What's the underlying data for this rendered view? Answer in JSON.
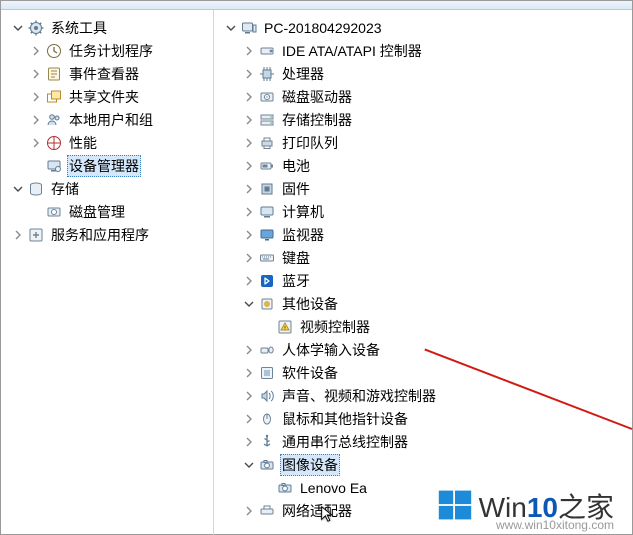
{
  "watermark": {
    "brand_a": "Win",
    "brand_b": "10",
    "brand_c": "之家",
    "url": "www.win10xitong.com"
  },
  "icons": {
    "gear": "<svg viewBox='0 0 16 16'><circle cx='8' cy='8' r='5.5' fill='#dde6ee' stroke='#5f7b93'/><circle cx='8' cy='8' r='2' fill='#5f7b93'/><g stroke='#5f7b93' stroke-width='1.4'><line x1='8' y1='0.5' x2='8' y2='3'/><line x1='8' y1='13' x2='8' y2='15.5'/><line x1='0.5' y1='8' x2='3' y2='8'/><line x1='13' y1='8' x2='15.5' y2='8'/><line x1='2.8' y1='2.8' x2='4.5' y2='4.5'/><line x1='11.5' y1='11.5' x2='13.2' y2='13.2'/><line x1='13.2' y1='2.8' x2='11.5' y2='4.5'/><line x1='4.5' y1='11.5' x2='2.8' y2='13.2'/></g></svg>",
    "clock": "<svg viewBox='0 0 16 16'><circle cx='8' cy='8' r='6.5' fill='#fff' stroke='#7a6d3d' stroke-width='1'/><path d='M8 4v4l3 2' stroke='#7a6d3d' stroke-width='1.3' fill='none'/></svg>",
    "event": "<svg viewBox='0 0 16 16'><rect x='2.5' y='2' width='11' height='12' rx='1' fill='#fdf6e3' stroke='#9a874b'/><line x1='5' y1='5' x2='11' y2='5' stroke='#9a874b'/><line x1='5' y1='8' x2='11' y2='8' stroke='#9a874b'/><line x1='5' y1='11' x2='9' y2='11' stroke='#9a874b'/></svg>",
    "share": "<svg viewBox='0 0 16 16'><rect x='1.5' y='5' width='9' height='8' fill='#fff' stroke='#c08a2a'/><rect x='5.5' y='2' width='9' height='8' fill='#ffe9a8' stroke='#c08a2a'/></svg>",
    "users": "<svg viewBox='0 0 16 16'><circle cx='6' cy='5' r='2.3' fill='#cfe0ee' stroke='#5f7b93'/><path d='M2 13c0-2.5 1.8-4 4-4s4 1.5 4 4' fill='#cfe0ee' stroke='#5f7b93'/><circle cx='11' cy='6' r='2' fill='#cfe0ee' stroke='#5f7b93'/></svg>",
    "perf": "<svg viewBox='0 0 16 16'><circle cx='8' cy='8' r='6.5' fill='#fff' stroke='#b03030'/><line x1='8' y1='1.5' x2='8' y2='14.5' stroke='#b03030'/><line x1='1.5' y1='8' x2='14.5' y2='8' stroke='#b03030'/></svg>",
    "devmgr": "<svg viewBox='0 0 16 16'><rect x='2' y='3' width='12' height='8' rx='1' fill='#d8e6f2' stroke='#5f7b93'/><rect x='5' y='12' width='6' height='1.5' fill='#5f7b93'/><circle cx='12' cy='11' r='2.5' fill='#eef3f7' stroke='#5f7b93'/></svg>",
    "storage": "<svg viewBox='0 0 16 16'><ellipse cx='8' cy='4' rx='5.5' ry='2' fill='#e7eef5' stroke='#6e8397'/><path d='M2.5 4v8a5.5 2 0 0 0 11 0V4' fill='#e7eef5' stroke='#6e8397'/></svg>",
    "diskmgr": "<svg viewBox='0 0 16 16'><rect x='2' y='4' width='12' height='8' rx='1' fill='#e7eef5' stroke='#6e8397'/><circle cx='8' cy='8' r='2.5' fill='#fff' stroke='#6e8397'/></svg>",
    "services": "<svg viewBox='0 0 16 16'><rect x='2' y='2' width='12' height='12' rx='1' fill='#eef3f7' stroke='#6e8397'/><path d='M5 8h6M8 5v6' stroke='#6e8397' stroke-width='1.4'/></svg>",
    "pc": "<svg viewBox='0 0 16 16'><rect x='1.5' y='3' width='10' height='8' rx='1' fill='#dfe9f2' stroke='#5f7b93'/><rect x='4' y='12' width='5' height='1.5' fill='#5f7b93'/><rect x='12' y='5' width='3' height='7' fill='#dfe9f2' stroke='#5f7b93'/></svg>",
    "ide": "<svg viewBox='0 0 16 16'><rect x='2' y='5' width='12' height='6' rx='1' fill='#e7eef5' stroke='#6e8397'/><circle cx='12' cy='8' r='1.4' fill='#6e8397'/></svg>",
    "cpu": "<svg viewBox='0 0 16 16'><rect x='4' y='4' width='8' height='8' fill='#c7d6e3' stroke='#5f7b93'/><g stroke='#5f7b93'><line x1='8' y1='1' x2='8' y2='3.5'/><line x1='8' y1='12.5' x2='8' y2='15'/><line x1='1' y1='8' x2='3.5' y2='8'/><line x1='12.5' y1='8' x2='15' y2='8'/><line x1='5' y1='1' x2='5' y2='3.5'/><line x1='11' y1='1' x2='11' y2='3.5'/><line x1='5' y1='12.5' x2='5' y2='15'/><line x1='11' y1='12.5' x2='11' y2='15'/></g></svg>",
    "disk": "<svg viewBox='0 0 16 16'><rect x='2' y='4' width='12' height='8' rx='1' fill='#e7eef5' stroke='#6e8397'/><circle cx='8' cy='8' r='2.5' fill='#fff' stroke='#6e8397'/><circle cx='8' cy='8' r='.7' fill='#6e8397'/></svg>",
    "stor": "<svg viewBox='0 0 16 16'><rect x='2' y='3' width='12' height='4' fill='#e7eef5' stroke='#6e8397'/><rect x='2' y='9' width='12' height='4' fill='#e7eef5' stroke='#6e8397'/><circle cx='12' cy='5' r='.8' fill='#55b357'/><circle cx='12' cy='11' r='.8' fill='#55b357'/></svg>",
    "printer": "<svg viewBox='0 0 16 16'><rect x='3' y='6' width='10' height='5' fill='#cdd9e3' stroke='#6e8397'/><rect x='5' y='3' width='6' height='3' fill='#fff' stroke='#6e8397'/><rect x='5' y='11' width='6' height='2.5' fill='#fff' stroke='#6e8397'/></svg>",
    "battery": "<svg viewBox='0 0 16 16'><rect x='2' y='5' width='10' height='6' rx='1' fill='#e7eef5' stroke='#6e8397'/><rect x='12.5' y='6.5' width='1.5' height='3' fill='#6e8397'/><rect x='3.5' y='6.5' width='5' height='3' fill='#6e8397'/></svg>",
    "firmware": "<svg viewBox='0 0 16 16'><rect x='3' y='3' width='10' height='10' fill='#c7d6e3' stroke='#5f7b93'/><rect x='5.5' y='5.5' width='5' height='5' fill='#5f7b93'/></svg>",
    "computer": "<svg viewBox='0 0 16 16'><rect x='2' y='3' width='12' height='8' rx='1' fill='#d8e6f2' stroke='#5f7b93'/><rect x='5' y='12' width='6' height='1.5' fill='#5f7b93'/></svg>",
    "monitor": "<svg viewBox='0 0 16 16'><rect x='2' y='3' width='12' height='8' rx='1' fill='#6aa5d8' stroke='#3a6c99'/><rect x='6' y='12' width='4' height='1.5' fill='#3a6c99'/></svg>",
    "keyboard": "<svg viewBox='0 0 16 16'><rect x='1.5' y='5' width='13' height='6' rx='1' fill='#eef3f7' stroke='#6e8397'/><g fill='#6e8397'><rect x='3' y='6.5' width='1' height='1'/><rect x='5' y='6.5' width='1' height='1'/><rect x='7' y='6.5' width='1' height='1'/><rect x='9' y='6.5' width='1' height='1'/><rect x='11' y='6.5' width='1' height='1'/><rect x='4' y='8.5' width='6' height='1'/></g></svg>",
    "bt": "<svg viewBox='0 0 16 16'><rect x='2' y='2' width='12' height='12' rx='2' fill='#1766c1'/><path d='M6 5l4 3-4 3V5l4 3-4 3' stroke='#fff' stroke-width='1.3' fill='none' stroke-linejoin='round'/></svg>",
    "other": "<svg viewBox='0 0 16 16'><rect x='3' y='3' width='10' height='10' rx='1' fill='#eef3f7' stroke='#6e8397'/><circle cx='8' cy='8' r='3' fill='#e0b44a'/></svg>",
    "warn": "<svg viewBox='0 0 16 16'><rect x='2' y='2' width='12' height='12' rx='1' fill='#eef3f7' stroke='#6e8397'/><path d='M8 4l4 7H4z' fill='#f7d24a' stroke='#b8902d'/><rect x='7.5' y='7' width='1' height='2' fill='#7a5c13'/><rect x='7.5' y='9.6' width='1' height='1' fill='#7a5c13'/></svg>",
    "hid": "<svg viewBox='0 0 16 16'><rect x='2' y='6' width='7' height='5' rx='1' fill='#e7eef5' stroke='#6e8397'/><ellipse cx='12' cy='8' rx='2.2' ry='3' fill='#e7eef5' stroke='#6e8397'/></svg>",
    "soft": "<svg viewBox='0 0 16 16'><rect x='2.5' y='2.5' width='11' height='11' rx='1' fill='#eef3f7' stroke='#6e8397'/><rect x='5' y='5' width='6' height='6' fill='#a9c3d8'/></svg>",
    "audio": "<svg viewBox='0 0 16 16'><path d='M3 6h2l3-3v10l-3-3H3z' fill='#c7d6e3' stroke='#5f7b93'/><path d='M10 5c1.5 1 1.5 5 0 6M12 3c3 2 3 8 0 10' stroke='#5f7b93' fill='none'/></svg>",
    "mouse": "<svg viewBox='0 0 16 16'><ellipse cx='8' cy='8' rx='3.5' ry='5' fill='#eef3f7' stroke='#6e8397'/><line x1='8' y1='3' x2='8' y2='8' stroke='#6e8397'/></svg>",
    "usb": "<svg viewBox='0 0 16 16'><path d='M8 2v10M8 12l-3-2M8 12l3-2M8 6l-2.5-1.5M8 8l2.5-1.5' stroke='#5f7b93' stroke-width='1.3' fill='none'/><circle cx='8' cy='2' r='1.2' fill='#5f7b93'/></svg>",
    "camera": "<svg viewBox='0 0 16 16'><rect x='2' y='5' width='12' height='7' rx='1' fill='#d8e6f2' stroke='#5f7b93'/><circle cx='8' cy='8.5' r='2.4' fill='#fff' stroke='#5f7b93'/><rect x='5' y='3.5' width='3' height='2' fill='#d8e6f2' stroke='#5f7b93'/></svg>",
    "net": "<svg viewBox='0 0 16 16'><rect x='2' y='6' width='12' height='5' rx='1' fill='#e7eef5' stroke='#6e8397'/><path d='M5 6V3h6v3' stroke='#6e8397' fill='none'/></svg>"
  },
  "left_tree": [
    {
      "indent": 0,
      "chev": "down",
      "icon": "gear",
      "label": "系统工具",
      "name": "system-tools"
    },
    {
      "indent": 1,
      "chev": "right",
      "icon": "clock",
      "label": "任务计划程序",
      "name": "task-scheduler"
    },
    {
      "indent": 1,
      "chev": "right",
      "icon": "event",
      "label": "事件查看器",
      "name": "event-viewer"
    },
    {
      "indent": 1,
      "chev": "right",
      "icon": "share",
      "label": "共享文件夹",
      "name": "shared-folders"
    },
    {
      "indent": 1,
      "chev": "right",
      "icon": "users",
      "label": "本地用户和组",
      "name": "local-users-groups"
    },
    {
      "indent": 1,
      "chev": "right",
      "icon": "perf",
      "label": "性能",
      "name": "performance"
    },
    {
      "indent": 1,
      "chev": "",
      "icon": "devmgr",
      "label": "设备管理器",
      "name": "device-manager",
      "selected": true
    },
    {
      "indent": 0,
      "chev": "down",
      "icon": "storage",
      "label": "存储",
      "name": "storage"
    },
    {
      "indent": 1,
      "chev": "",
      "icon": "diskmgr",
      "label": "磁盘管理",
      "name": "disk-management"
    },
    {
      "indent": 0,
      "chev": "right",
      "icon": "services",
      "label": "服务和应用程序",
      "name": "services-apps"
    }
  ],
  "right_tree": [
    {
      "indent": 0,
      "chev": "down",
      "icon": "pc",
      "label": "PC-201804292023",
      "name": "root-pc"
    },
    {
      "indent": 1,
      "chev": "right",
      "icon": "ide",
      "label": "IDE ATA/ATAPI 控制器",
      "name": "cat-ide"
    },
    {
      "indent": 1,
      "chev": "right",
      "icon": "cpu",
      "label": "处理器",
      "name": "cat-cpu"
    },
    {
      "indent": 1,
      "chev": "right",
      "icon": "disk",
      "label": "磁盘驱动器",
      "name": "cat-disk-drives"
    },
    {
      "indent": 1,
      "chev": "right",
      "icon": "stor",
      "label": "存储控制器",
      "name": "cat-storage-controllers"
    },
    {
      "indent": 1,
      "chev": "right",
      "icon": "printer",
      "label": "打印队列",
      "name": "cat-print-queues"
    },
    {
      "indent": 1,
      "chev": "right",
      "icon": "battery",
      "label": "电池",
      "name": "cat-battery"
    },
    {
      "indent": 1,
      "chev": "right",
      "icon": "firmware",
      "label": "固件",
      "name": "cat-firmware"
    },
    {
      "indent": 1,
      "chev": "right",
      "icon": "computer",
      "label": "计算机",
      "name": "cat-computer"
    },
    {
      "indent": 1,
      "chev": "right",
      "icon": "monitor",
      "label": "监视器",
      "name": "cat-monitors"
    },
    {
      "indent": 1,
      "chev": "right",
      "icon": "keyboard",
      "label": "键盘",
      "name": "cat-keyboards"
    },
    {
      "indent": 1,
      "chev": "right",
      "icon": "bt",
      "label": "蓝牙",
      "name": "cat-bluetooth"
    },
    {
      "indent": 1,
      "chev": "down",
      "icon": "other",
      "label": "其他设备",
      "name": "cat-other-devices"
    },
    {
      "indent": 2,
      "chev": "",
      "icon": "warn",
      "label": "视频控制器",
      "name": "dev-video-controller"
    },
    {
      "indent": 1,
      "chev": "right",
      "icon": "hid",
      "label": "人体学输入设备",
      "name": "cat-hid"
    },
    {
      "indent": 1,
      "chev": "right",
      "icon": "soft",
      "label": "软件设备",
      "name": "cat-software-devices"
    },
    {
      "indent": 1,
      "chev": "right",
      "icon": "audio",
      "label": "声音、视频和游戏控制器",
      "name": "cat-audio"
    },
    {
      "indent": 1,
      "chev": "right",
      "icon": "mouse",
      "label": "鼠标和其他指针设备",
      "name": "cat-mice"
    },
    {
      "indent": 1,
      "chev": "right",
      "icon": "usb",
      "label": "通用串行总线控制器",
      "name": "cat-usb"
    },
    {
      "indent": 1,
      "chev": "down",
      "icon": "camera",
      "label": "图像设备",
      "name": "cat-imaging",
      "selected": true
    },
    {
      "indent": 2,
      "chev": "",
      "icon": "camera",
      "label": "Lenovo Ea",
      "name": "dev-lenovo-camera"
    },
    {
      "indent": 1,
      "chev": "right",
      "icon": "net",
      "label": "网络适配器",
      "name": "cat-network-adapters"
    }
  ]
}
